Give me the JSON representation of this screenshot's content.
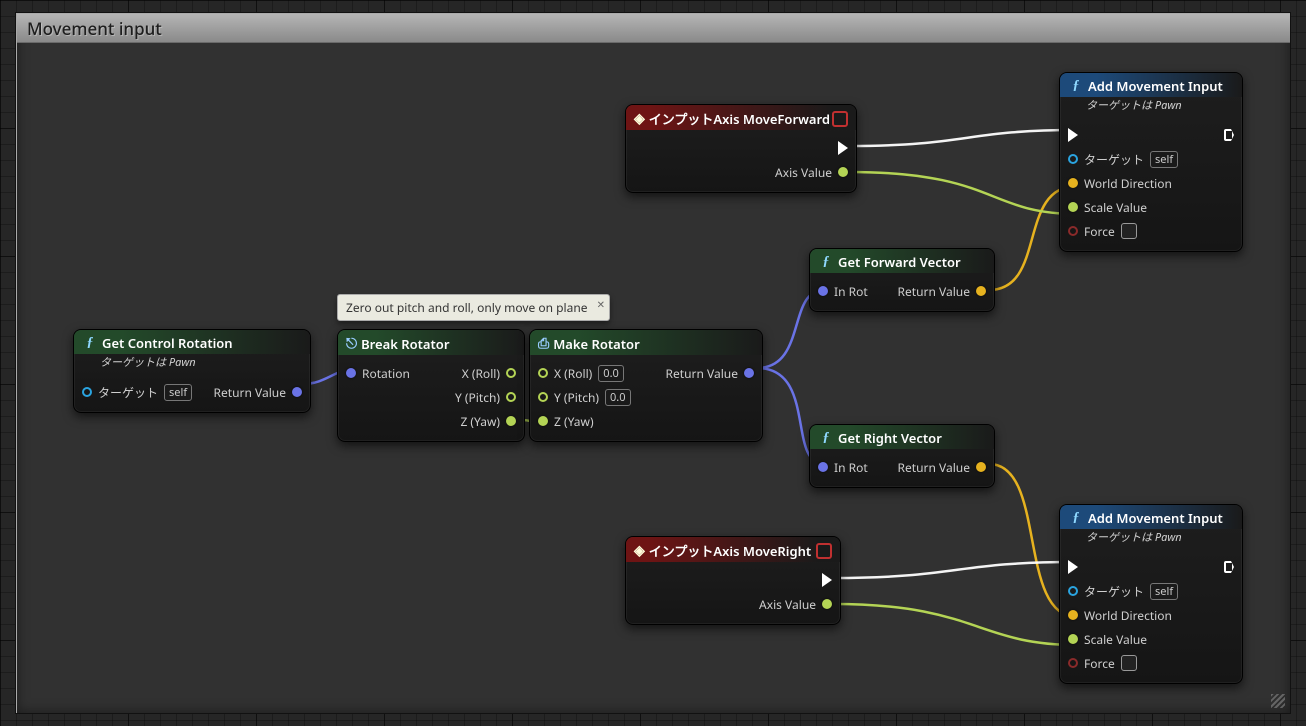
{
  "comment_title": "Movement input",
  "tooltip": "Zero out pitch and roll, only move on plane",
  "nodes": {
    "get_control_rotation": {
      "title": "Get Control Rotation",
      "subtitle": "ターゲットは Pawn",
      "pin_target": "ターゲット",
      "pin_self": "self",
      "pin_return": "Return Value"
    },
    "break_rotator": {
      "title": "Break Rotator",
      "pin_rotation": "Rotation",
      "pin_x": "X (Roll)",
      "pin_y": "Y (Pitch)",
      "pin_z": "Z (Yaw)"
    },
    "make_rotator": {
      "title": "Make Rotator",
      "pin_x": "X (Roll)",
      "pin_y": "Y (Pitch)",
      "pin_z": "Z (Yaw)",
      "pin_return": "Return Value",
      "x_value": "0.0",
      "y_value": "0.0"
    },
    "input_axis_forward": {
      "title": "インプットAxis MoveForward",
      "pin_axis": "Axis Value"
    },
    "input_axis_right": {
      "title": "インプットAxis MoveRight",
      "pin_axis": "Axis Value"
    },
    "get_forward_vector": {
      "title": "Get Forward Vector",
      "pin_in": "In Rot",
      "pin_return": "Return Value"
    },
    "get_right_vector": {
      "title": "Get Right Vector",
      "pin_in": "In Rot",
      "pin_return": "Return Value"
    },
    "add_movement_input_a": {
      "title": "Add Movement Input",
      "subtitle": "ターゲットは Pawn",
      "pin_target": "ターゲット",
      "pin_self": "self",
      "pin_world_dir": "World Direction",
      "pin_scale": "Scale Value",
      "pin_force": "Force"
    },
    "add_movement_input_b": {
      "title": "Add Movement Input",
      "subtitle": "ターゲットは Pawn",
      "pin_target": "ターゲット",
      "pin_self": "self",
      "pin_world_dir": "World Direction",
      "pin_scale": "Scale Value",
      "pin_force": "Force"
    }
  },
  "colors": {
    "struct": "#6a73e6",
    "float": "#b4d455",
    "vector": "#e6b21f",
    "bool": "#8a2a2a",
    "object": "#2aa4e0",
    "exec": "#ffffff"
  }
}
